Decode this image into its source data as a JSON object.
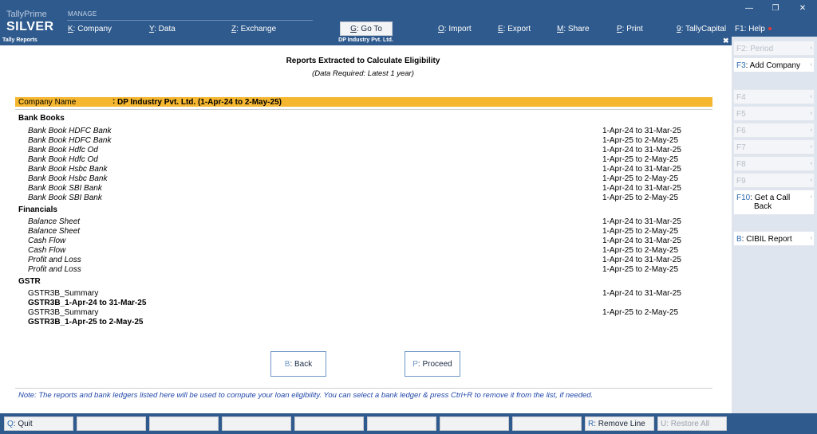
{
  "app": {
    "brand_line1": "TallyPrime",
    "brand_line2": "SILVER",
    "manage_label": "MANAGE"
  },
  "top_menu": [
    {
      "key": "K",
      "label": ": Company"
    },
    {
      "key": "Y",
      "label": ": Data"
    },
    {
      "key": "Z",
      "label": ": Exchange"
    },
    {
      "key": "G",
      "label": ": Go To"
    },
    {
      "key": "O",
      "label": ": Import"
    },
    {
      "key": "E",
      "label": ": Export"
    },
    {
      "key": "M",
      "label": ": Share"
    },
    {
      "key": "P",
      "label": ": Print"
    },
    {
      "key": "9",
      "label": ": TallyCapital"
    }
  ],
  "help": {
    "label": "F1: Help"
  },
  "window_controls": {
    "minimize": "—",
    "restore": "❐",
    "close": "✕"
  },
  "title_strip": {
    "left": "Tally Reports",
    "center": "DP Industry Pvt. Ltd.",
    "close": "✖"
  },
  "report": {
    "title": "Reports Extracted to Calculate Eligibility",
    "subtitle": "(Data Required: Latest 1 year)",
    "company_label": "Company Name",
    "company_sep": ":",
    "company_value": "DP Industry Pvt. Ltd. (1-Apr-24 to 2-May-25)"
  },
  "sections": {
    "bank_books": {
      "heading": "Bank Books",
      "items": [
        {
          "name": "Bank Book HDFC Bank",
          "period": "1-Apr-24 to 31-Mar-25"
        },
        {
          "name": "Bank Book HDFC Bank",
          "period": "1-Apr-25 to 2-May-25"
        },
        {
          "name": "Bank Book Hdfc Od",
          "period": "1-Apr-24 to 31-Mar-25"
        },
        {
          "name": "Bank Book Hdfc Od",
          "period": "1-Apr-25 to 2-May-25"
        },
        {
          "name": "Bank Book Hsbc Bank",
          "period": "1-Apr-24 to 31-Mar-25"
        },
        {
          "name": "Bank Book Hsbc Bank",
          "period": "1-Apr-25 to 2-May-25"
        },
        {
          "name": "Bank Book SBI Bank",
          "period": "1-Apr-24 to 31-Mar-25"
        },
        {
          "name": "Bank Book SBI Bank",
          "period": "1-Apr-25 to 2-May-25"
        }
      ]
    },
    "financials": {
      "heading": "Financials",
      "items": [
        {
          "name": "Balance Sheet",
          "period": "1-Apr-24 to 31-Mar-25"
        },
        {
          "name": "Balance Sheet",
          "period": "1-Apr-25 to 2-May-25"
        },
        {
          "name": "Cash Flow",
          "period": "1-Apr-24 to 31-Mar-25"
        },
        {
          "name": "Cash Flow",
          "period": "1-Apr-25 to 2-May-25"
        },
        {
          "name": "Profit and Loss",
          "period": "1-Apr-24 to 31-Mar-25"
        },
        {
          "name": "Profit and Loss",
          "period": "1-Apr-25 to 2-May-25"
        }
      ]
    },
    "gstr": {
      "heading": "GSTR",
      "items": [
        {
          "name": "GSTR3B_Summary",
          "period": "1-Apr-24 to 31-Mar-25"
        },
        {
          "name": "GSTR3B_1-Apr-24 to 31-Mar-25",
          "period": ""
        },
        {
          "name": "GSTR3B_Summary",
          "period": "1-Apr-25 to 2-May-25"
        },
        {
          "name": "GSTR3B_1-Apr-25 to 2-May-25",
          "period": ""
        }
      ]
    }
  },
  "buttons": {
    "back": {
      "key": "B",
      "label": ": Back"
    },
    "proceed": {
      "key": "P",
      "label": ": Proceed"
    }
  },
  "note": "Note: The reports and bank ledgers listed here will be used to compute your loan eligibility. You can select a bank ledger & press Ctrl+R to remove it from the list, if needed.",
  "right_panel": [
    {
      "key": "F2",
      "label": ": Period",
      "enabled": false
    },
    {
      "key": "F3",
      "label": ": Add Company",
      "enabled": true
    },
    {
      "key": "F4",
      "label": "",
      "enabled": false
    },
    {
      "key": "F5",
      "label": "",
      "enabled": false
    },
    {
      "key": "F6",
      "label": "",
      "enabled": false
    },
    {
      "key": "F7",
      "label": "",
      "enabled": false
    },
    {
      "key": "F8",
      "label": "",
      "enabled": false
    },
    {
      "key": "F9",
      "label": "",
      "enabled": false
    },
    {
      "key": "F10",
      "label": ": Get a Call",
      "label2": "Back",
      "enabled": true
    },
    {
      "key": "B",
      "label": ": CIBIL Report",
      "enabled": true
    }
  ],
  "bottom_bar": {
    "quit": {
      "key": "Q",
      "label": ": Quit"
    },
    "remove_line": {
      "key": "R",
      "label": ": Remove Line"
    },
    "restore_all": {
      "key": "U",
      "label": ": Restore All"
    }
  },
  "colors": {
    "header": "#2f5a8d",
    "company_bar": "#f5b630",
    "note": "#2147a8",
    "key_accent": "#2e6bb0"
  }
}
